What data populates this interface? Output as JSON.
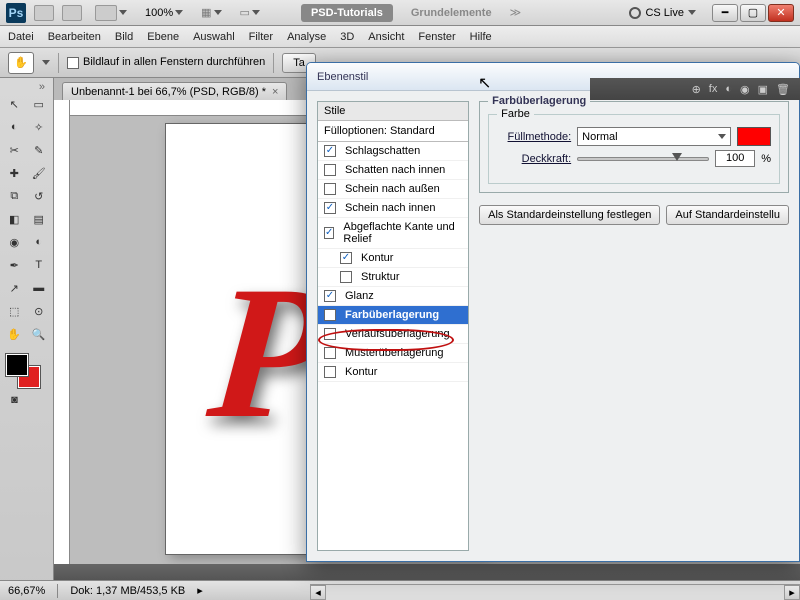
{
  "app": {
    "id": "Ps",
    "cslive": "CS Live",
    "zoom_val": "100%"
  },
  "menu": [
    "Datei",
    "Bearbeiten",
    "Bild",
    "Ebene",
    "Auswahl",
    "Filter",
    "Analyse",
    "3D",
    "Ansicht",
    "Fenster",
    "Hilfe"
  ],
  "optbar": {
    "scroll_all": "Bildlauf in allen Fenstern durchführen",
    "btn1": "Ta"
  },
  "tabs": {
    "t1": "PSD-Tutorials",
    "t2": "Grundelemente"
  },
  "doc": {
    "title": "Unbenannt-1 bei 66,7% (PSD, RGB/8) *"
  },
  "status": {
    "zoom": "66,67%",
    "doksize": "Dok: 1,37 MB/453,5 KB"
  },
  "dialog": {
    "title": "Ebenenstil",
    "styles_header": "Stile",
    "opts": "Fülloptionen: Standard",
    "items": [
      {
        "label": "Schlagschatten",
        "checked": true
      },
      {
        "label": "Schatten nach innen",
        "checked": false
      },
      {
        "label": "Schein nach außen",
        "checked": false
      },
      {
        "label": "Schein nach innen",
        "checked": true
      },
      {
        "label": "Abgeflachte Kante und Relief",
        "checked": true
      },
      {
        "label": "Kontur",
        "checked": true,
        "indent": true
      },
      {
        "label": "Struktur",
        "checked": false,
        "indent": true
      },
      {
        "label": "Glanz",
        "checked": true
      },
      {
        "label": "Farbüberlagerung",
        "checked": true,
        "selected": true
      },
      {
        "label": "Verlaufsüberlagerung",
        "checked": false
      },
      {
        "label": "Musterüberlagerung",
        "checked": false
      },
      {
        "label": "Kontur",
        "checked": false
      }
    ],
    "panel_title": "Farbüberlagerung",
    "group_title": "Farbe",
    "blend_label": "Füllmethode:",
    "blend_value": "Normal",
    "opacity_label": "Deckkraft:",
    "opacity_value": "100",
    "opacity_unit": "%",
    "btn_default_set": "Als Standardeinstellung festlegen",
    "btn_default_reset": "Auf Standardeinstellu",
    "color": "#ff0000"
  }
}
